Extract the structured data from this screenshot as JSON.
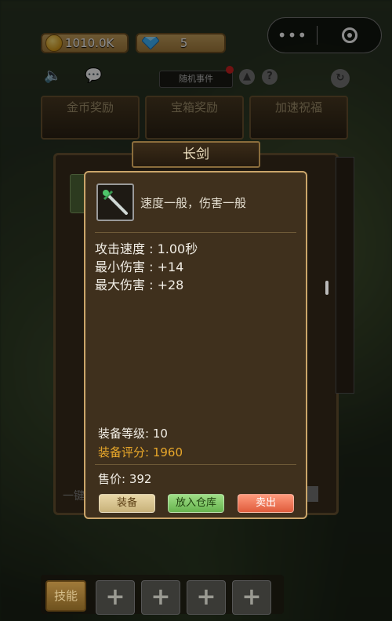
{
  "top_bar": {
    "gold": "1010.0K",
    "gems": "5"
  },
  "mini_program": {
    "more_glyph": "•••",
    "close_icon": "target-circle-icon"
  },
  "header": {
    "event_button": "随机事件"
  },
  "reward_tabs": [
    "金币奖励",
    "宝箱奖励",
    "加速祝福"
  ],
  "dialog": {
    "title": "长剑",
    "item_icon": "sword-icon",
    "description": "速度一般，伤害一般",
    "stats": [
      "攻击速度 : 1.00秒",
      "最小伤害 : +14",
      "最大伤害 : +28"
    ],
    "equip_level": "装备等级: 10",
    "equip_score": "装备评分: 1960",
    "price": "售价:  392",
    "buttons": {
      "equip": "装备",
      "store": "放入仓库",
      "sell": "卖出"
    }
  },
  "bottom": {
    "skills_label": "技能",
    "partial_left": "一键",
    "slot_glyph": "+"
  },
  "colors": {
    "score_gold": "#e8a72a",
    "card_border": "#caa56a",
    "sell_red": "#e05c3c",
    "store_green": "#67b34e"
  }
}
